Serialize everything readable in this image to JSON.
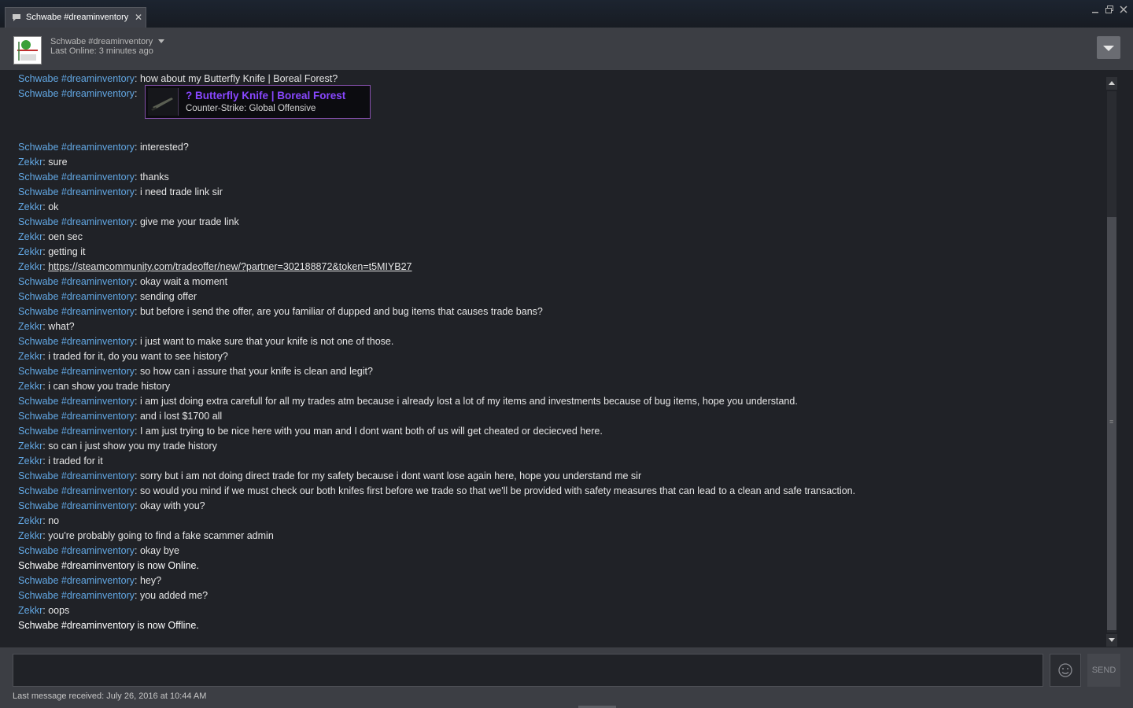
{
  "tab": {
    "icon": "chat-bubble-icon",
    "label": "Schwabe #dreaminventory",
    "close": "✕"
  },
  "window_controls": [
    "minimize-icon",
    "restore-icon",
    "close-icon"
  ],
  "header": {
    "friend_name": "Schwabe #dreaminventory",
    "status": "Last Online: 3 minutes ago"
  },
  "item_card": {
    "name": "? Butterfly Knife | Boreal Forest",
    "game": "Counter-Strike: Global Offensive",
    "color": "#8847ff"
  },
  "messages": [
    {
      "sender": "Schwabe #dreaminventory",
      "text": "how about my Butterfly Knife | Boreal Forest?"
    },
    {
      "sender": "Schwabe #dreaminventory",
      "text": ""
    },
    {
      "sender": "Schwabe #dreaminventory",
      "text": "interested?"
    },
    {
      "sender": "Zekkr",
      "text": "sure"
    },
    {
      "sender": "Schwabe #dreaminventory",
      "text": "thanks"
    },
    {
      "sender": "Schwabe #dreaminventory",
      "text": "i need trade link sir"
    },
    {
      "sender": "Zekkr",
      "text": "ok"
    },
    {
      "sender": "Schwabe #dreaminventory",
      "text": "give me your trade link"
    },
    {
      "sender": "Zekkr",
      "text": "oen sec"
    },
    {
      "sender": "Zekkr",
      "text": "getting it"
    },
    {
      "sender": "Zekkr",
      "text": "https://steamcommunity.com/tradeoffer/new/?partner=302188872&token=t5MIYB27",
      "link": true
    },
    {
      "sender": "Schwabe #dreaminventory",
      "text": "okay wait a moment"
    },
    {
      "sender": "Schwabe #dreaminventory",
      "text": "sending offer"
    },
    {
      "sender": "Schwabe #dreaminventory",
      "text": "but before i send the offer, are you familiar of dupped and bug items that causes trade bans?"
    },
    {
      "sender": "Zekkr",
      "text": "what?"
    },
    {
      "sender": "Schwabe #dreaminventory",
      "text": "i just want to make sure that your knife is not one of those."
    },
    {
      "sender": "Zekkr",
      "text": "i traded for it, do you want to see history?"
    },
    {
      "sender": "Schwabe #dreaminventory",
      "text": "so how can i assure that your knife is clean and legit?"
    },
    {
      "sender": "Zekkr",
      "text": "i can show you trade history"
    },
    {
      "sender": "Schwabe #dreaminventory",
      "text": "i am just doing extra carefull for all my trades atm because i already lost a lot of my items and investments because of bug items, hope you understand."
    },
    {
      "sender": "Schwabe #dreaminventory",
      "text": "and i lost $1700 all"
    },
    {
      "sender": "Schwabe #dreaminventory",
      "text": "I am just trying to be nice here with you man and I dont want both of us will get cheated or deciecved here."
    },
    {
      "sender": "Zekkr",
      "text": "so can i just show you my trade history"
    },
    {
      "sender": "Zekkr",
      "text": "i traded for it"
    },
    {
      "sender": "Schwabe #dreaminventory",
      "text": "sorry but i am not doing direct trade for my safety because i dont want lose again here, hope you understand me sir"
    },
    {
      "sender": "Schwabe #dreaminventory",
      "text": "so would you mind if we must check our both knifes first before we trade so that we'll be provided with safety measures that can lead to a clean and safe transaction."
    },
    {
      "sender": "Schwabe #dreaminventory",
      "text": "okay with you?"
    },
    {
      "sender": "Zekkr",
      "text": "no"
    },
    {
      "sender": "Zekkr",
      "text": "you're probably going to find a fake scammer admin"
    },
    {
      "sender": "Schwabe #dreaminventory",
      "text": "okay bye"
    },
    {
      "system": "Schwabe #dreaminventory is now Online."
    },
    {
      "sender": "Schwabe #dreaminventory",
      "text": "hey?"
    },
    {
      "sender": "Schwabe #dreaminventory",
      "text": "you added me?"
    },
    {
      "sender": "Zekkr",
      "text": "oops"
    },
    {
      "system": "Schwabe #dreaminventory is now Offline."
    }
  ],
  "footer": {
    "send_label": "SEND",
    "emoticon_icon": "smiley-icon",
    "last_received": "Last message received: July 26, 2016 at 10:44 AM"
  },
  "colors": {
    "sender": "#62a7e3",
    "text": "#e6e6e6",
    "background": "#202227",
    "panel": "#3c3e44"
  }
}
